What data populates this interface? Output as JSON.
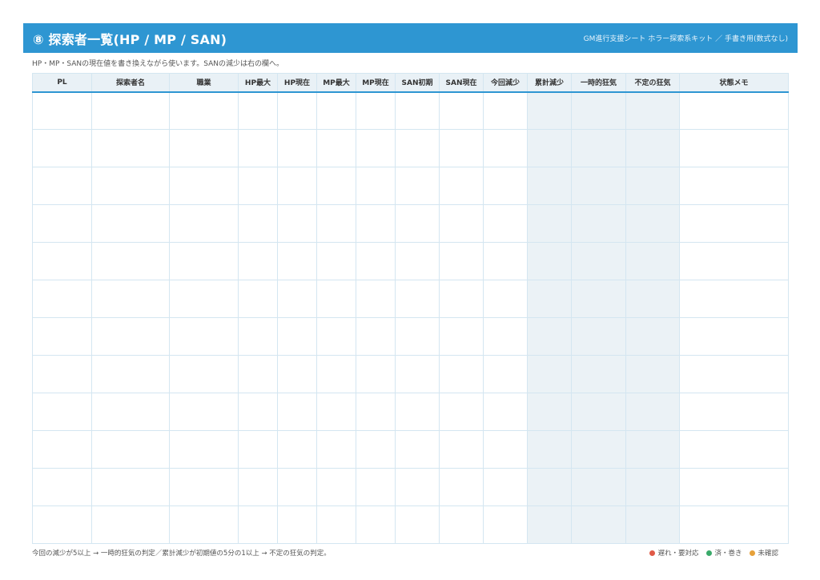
{
  "header": {
    "title": "⑧ 探索者一覧(HP / MP / SAN)",
    "subtitle": "GM進行支援シート ホラー探索系キット ／ 手書き用(数式なし)"
  },
  "note": "HP・MP・SANの現在値を書き換えながら使います。SANの減少は右の欄へ。",
  "table": {
    "columns": [
      "PL",
      "探索者名",
      "職業",
      "HP最大",
      "HP現在",
      "MP最大",
      "MP現在",
      "SAN初期",
      "SAN現在",
      "今回減少",
      "累計減少",
      "一時的狂気",
      "不定の狂気",
      "状態メモ"
    ],
    "shaded_columns": [
      10,
      11,
      12
    ],
    "row_count": 12
  },
  "footer": {
    "note": "今回の減少が5以上 → 一時的狂気の判定／累計減少が初期値の5分の1以上 → 不定の狂気の判定。"
  },
  "legend": [
    {
      "label": "遅れ・要対応",
      "color": "#e05a47"
    },
    {
      "label": "済・巻き",
      "color": "#3aaa6a"
    },
    {
      "label": "未確認",
      "color": "#e6a13a"
    }
  ]
}
